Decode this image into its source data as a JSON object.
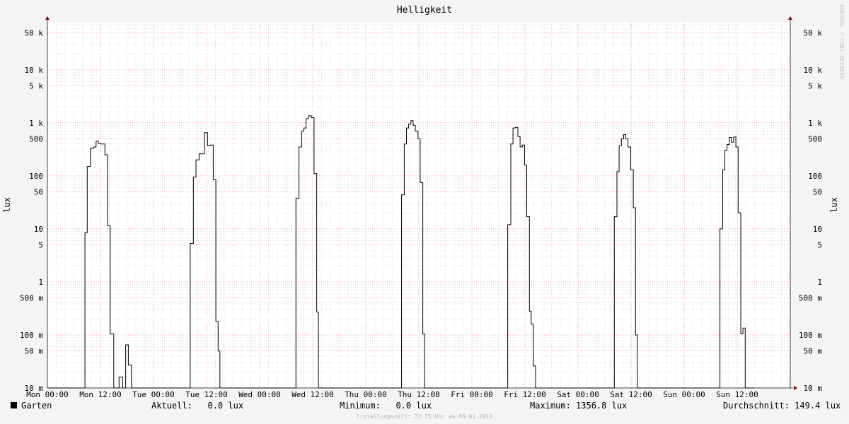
{
  "watermark": "RRDTOOL / TOBI OETIKER",
  "footer": "Erstellungszeit: 23:55 Uhr am 06.01.2019",
  "legend": {
    "series_label": "Garten",
    "current_label": "Aktuell:",
    "current_value": "0.0 lux",
    "min_label": "Minimum:",
    "min_value": "0.0 lux",
    "max_label": "Maximum:",
    "max_value": "1356.8 lux",
    "avg_label": "Durchschnitt:",
    "avg_value": "149.4 lux"
  },
  "colors": {
    "background": "#f4f4f4",
    "canvas": "#ffffff",
    "line": "#000000",
    "major_grid": "#f0a0a0",
    "minor_grid": "#d8d8d8",
    "axis": "#7f0000"
  },
  "chart_data": {
    "type": "line",
    "title": "Helligkeit",
    "ylabel": "lux",
    "ylabel_right": "lux",
    "yscale": "log",
    "ylim": [
      0.01,
      80000
    ],
    "grid": true,
    "xlim": [
      0,
      168
    ],
    "x_unit": "hours since Mon 00:00",
    "x_ticks": [
      {
        "x": 0,
        "label": "Mon 00:00"
      },
      {
        "x": 12,
        "label": "Mon 12:00"
      },
      {
        "x": 24,
        "label": "Tue 00:00"
      },
      {
        "x": 36,
        "label": "Tue 12:00"
      },
      {
        "x": 48,
        "label": "Wed 00:00"
      },
      {
        "x": 60,
        "label": "Wed 12:00"
      },
      {
        "x": 72,
        "label": "Thu 00:00"
      },
      {
        "x": 84,
        "label": "Thu 12:00"
      },
      {
        "x": 96,
        "label": "Fri 00:00"
      },
      {
        "x": 108,
        "label": "Fri 12:00"
      },
      {
        "x": 120,
        "label": "Sat 00:00"
      },
      {
        "x": 132,
        "label": "Sat 12:00"
      },
      {
        "x": 144,
        "label": "Sun 00:00"
      },
      {
        "x": 156,
        "label": "Sun 12:00"
      }
    ],
    "y_ticks": [
      {
        "v": 0.01,
        "label": "10 m"
      },
      {
        "v": 0.05,
        "label": "50 m"
      },
      {
        "v": 0.1,
        "label": "100 m"
      },
      {
        "v": 0.5,
        "label": "500 m"
      },
      {
        "v": 1,
        "label": "1"
      },
      {
        "v": 5,
        "label": "5"
      },
      {
        "v": 10,
        "label": "10"
      },
      {
        "v": 50,
        "label": "50"
      },
      {
        "v": 100,
        "label": "100"
      },
      {
        "v": 500,
        "label": "500"
      },
      {
        "v": 1000,
        "label": "1 k"
      },
      {
        "v": 5000,
        "label": "5 k"
      },
      {
        "v": 10000,
        "label": "10 k"
      },
      {
        "v": 50000,
        "label": "50 k"
      }
    ],
    "series": [
      {
        "name": "Garten",
        "step_values": [
          [
            0,
            0.0
          ],
          [
            8,
            0.0
          ],
          [
            8.5,
            8.5
          ],
          [
            9,
            150
          ],
          [
            9.7,
            330
          ],
          [
            10.5,
            350
          ],
          [
            11,
            450
          ],
          [
            11.5,
            410
          ],
          [
            12,
            400
          ],
          [
            13,
            250
          ],
          [
            13.6,
            11.5
          ],
          [
            14.2,
            0.105
          ],
          [
            15,
            0.0
          ],
          [
            16,
            0.0
          ],
          [
            16.2,
            0.016
          ],
          [
            17,
            0.0
          ],
          [
            17.7,
            0.065
          ],
          [
            18.3,
            0.027
          ],
          [
            19,
            0.0
          ],
          [
            32,
            0.0
          ],
          [
            32.3,
            5.3
          ],
          [
            33,
            95
          ],
          [
            33.6,
            200
          ],
          [
            34.3,
            260
          ],
          [
            35,
            260
          ],
          [
            35.5,
            650
          ],
          [
            36.2,
            370
          ],
          [
            36.8,
            380
          ],
          [
            37.5,
            85
          ],
          [
            38.1,
            0.18
          ],
          [
            38.6,
            0.05
          ],
          [
            39,
            0.0
          ],
          [
            56,
            0.0
          ],
          [
            56.2,
            38
          ],
          [
            56.9,
            350
          ],
          [
            57.5,
            700
          ],
          [
            58,
            800
          ],
          [
            58.5,
            1200
          ],
          [
            59,
            1356.8
          ],
          [
            59.7,
            1250
          ],
          [
            60.3,
            110
          ],
          [
            60.9,
            0.27
          ],
          [
            61.3,
            0.0
          ],
          [
            80,
            0.0
          ],
          [
            80.1,
            44
          ],
          [
            80.7,
            400
          ],
          [
            81.2,
            800
          ],
          [
            81.7,
            950
          ],
          [
            82.2,
            1100
          ],
          [
            82.7,
            900
          ],
          [
            83.2,
            700
          ],
          [
            83.8,
            500
          ],
          [
            84.3,
            75
          ],
          [
            84.9,
            0.105
          ],
          [
            85.3,
            0.0
          ],
          [
            104,
            0.0
          ],
          [
            104.1,
            12
          ],
          [
            104.8,
            400
          ],
          [
            105.3,
            800
          ],
          [
            105.8,
            820
          ],
          [
            106.4,
            550
          ],
          [
            106.9,
            350
          ],
          [
            107.4,
            380
          ],
          [
            107.9,
            160
          ],
          [
            108.4,
            17
          ],
          [
            109,
            0.28
          ],
          [
            109.4,
            0.16
          ],
          [
            109.9,
            0.026
          ],
          [
            110.4,
            0.0
          ],
          [
            128,
            0.0
          ],
          [
            128.2,
            17
          ],
          [
            128.8,
            120
          ],
          [
            129.3,
            370
          ],
          [
            129.8,
            500
          ],
          [
            130.3,
            600
          ],
          [
            130.8,
            500
          ],
          [
            131.3,
            350
          ],
          [
            131.9,
            130
          ],
          [
            132.5,
            25
          ],
          [
            133,
            0.1
          ],
          [
            133.4,
            0.0
          ],
          [
            152,
            0.0
          ],
          [
            152.1,
            10
          ],
          [
            152.7,
            130
          ],
          [
            153.2,
            300
          ],
          [
            153.7,
            390
          ],
          [
            154.2,
            530
          ],
          [
            154.7,
            430
          ],
          [
            155.2,
            540
          ],
          [
            155.7,
            350
          ],
          [
            156.2,
            20
          ],
          [
            156.8,
            0.105
          ],
          [
            157.3,
            0.135
          ],
          [
            157.8,
            0.0
          ],
          [
            160,
            0.0
          ]
        ]
      }
    ]
  }
}
